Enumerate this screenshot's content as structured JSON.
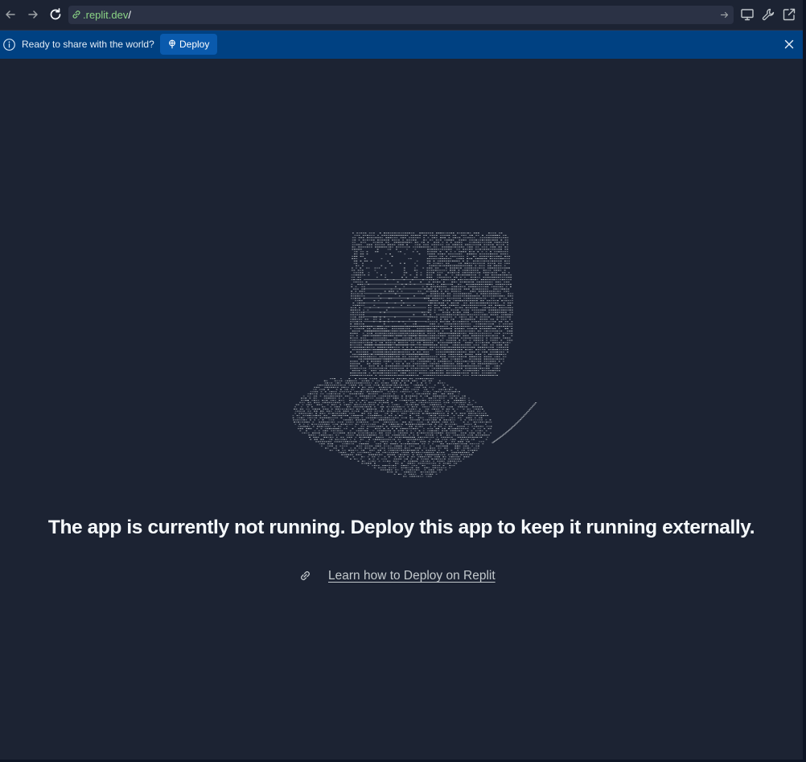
{
  "browser": {
    "url_domain": ".replit.dev",
    "url_path": "/",
    "icons": [
      "back-icon",
      "forward-icon",
      "reload-icon",
      "link-icon",
      "arrow-right-icon",
      "monitor-icon",
      "wrench-icon",
      "external-link-icon"
    ]
  },
  "banner": {
    "message": "Ready to share with the world?",
    "deploy_label": "Deploy",
    "icons": [
      "info-icon",
      "deploy-icon",
      "close-icon"
    ]
  },
  "main": {
    "headline": "The app is currently not running. Deploy this app to keep it running externally.",
    "learn_link": "Learn how to Deploy on Replit",
    "illustration": "ascii-art-laptop-hand"
  },
  "colors": {
    "background": "#1c2333",
    "banner": "#004182",
    "deploy_button": "#0a5aad",
    "url_domain": "#8bd485",
    "ascii_art": "#c2c8cc"
  }
}
